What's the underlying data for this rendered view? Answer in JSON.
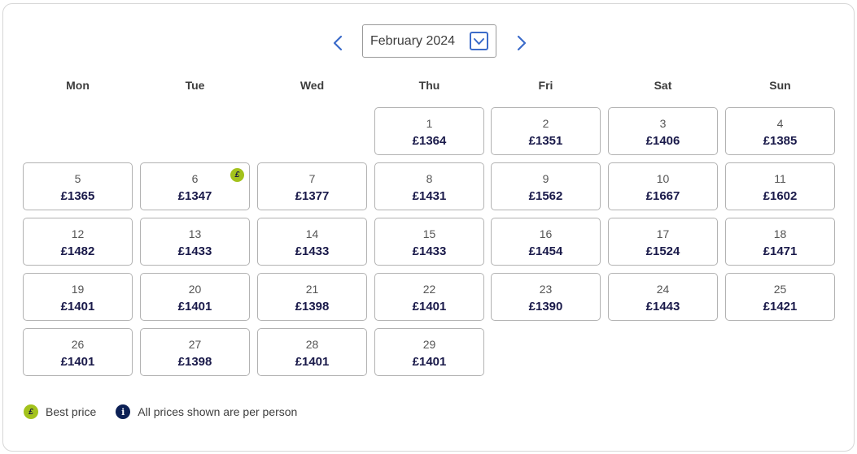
{
  "calendar": {
    "month_label": "February 2024",
    "weekdays": [
      "Mon",
      "Tue",
      "Wed",
      "Thu",
      "Fri",
      "Sat",
      "Sun"
    ],
    "days": [
      {
        "day": "1",
        "price": "£1364"
      },
      {
        "day": "2",
        "price": "£1351"
      },
      {
        "day": "3",
        "price": "£1406"
      },
      {
        "day": "4",
        "price": "£1385"
      },
      {
        "day": "5",
        "price": "£1365"
      },
      {
        "day": "6",
        "price": "£1347",
        "best": true
      },
      {
        "day": "7",
        "price": "£1377"
      },
      {
        "day": "8",
        "price": "£1431"
      },
      {
        "day": "9",
        "price": "£1562"
      },
      {
        "day": "10",
        "price": "£1667"
      },
      {
        "day": "11",
        "price": "£1602"
      },
      {
        "day": "12",
        "price": "£1482"
      },
      {
        "day": "13",
        "price": "£1433"
      },
      {
        "day": "14",
        "price": "£1433"
      },
      {
        "day": "15",
        "price": "£1433"
      },
      {
        "day": "16",
        "price": "£1454"
      },
      {
        "day": "17",
        "price": "£1524"
      },
      {
        "day": "18",
        "price": "£1471"
      },
      {
        "day": "19",
        "price": "£1401"
      },
      {
        "day": "20",
        "price": "£1401"
      },
      {
        "day": "21",
        "price": "£1398"
      },
      {
        "day": "22",
        "price": "£1401"
      },
      {
        "day": "23",
        "price": "£1390"
      },
      {
        "day": "24",
        "price": "£1443"
      },
      {
        "day": "25",
        "price": "£1421"
      },
      {
        "day": "26",
        "price": "£1401"
      },
      {
        "day": "27",
        "price": "£1398"
      },
      {
        "day": "28",
        "price": "£1401"
      },
      {
        "day": "29",
        "price": "£1401"
      }
    ]
  },
  "legend": {
    "badge_symbol": "£",
    "best_price_label": "Best price",
    "info_symbol": "i",
    "info_label": "All prices shown are per person"
  },
  "colors": {
    "accent": "#3b6bc9",
    "best_badge": "#a3c21c",
    "info_icon": "#0c2055",
    "price_text": "#1a1a4a"
  },
  "icons": {
    "prev": "chevron-left-icon",
    "next": "chevron-right-icon",
    "dropdown": "chevron-down-icon"
  }
}
